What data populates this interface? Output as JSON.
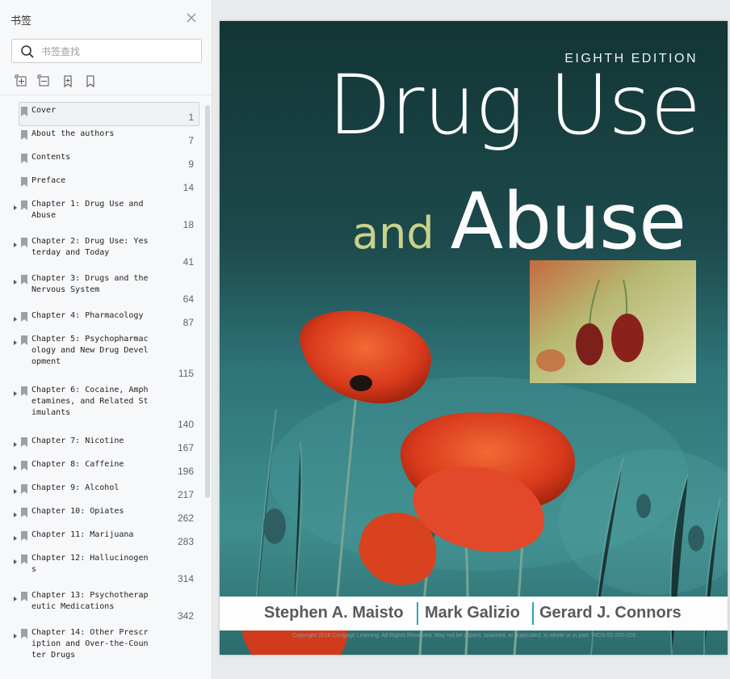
{
  "sidebar": {
    "title": "书签",
    "search_placeholder": "书签查找",
    "bookmarks": [
      {
        "label": "Cover",
        "page": "1",
        "expandable": false,
        "selected": true
      },
      {
        "label": "About the authors",
        "page": "7",
        "expandable": false
      },
      {
        "label": "Contents",
        "page": "9",
        "expandable": false
      },
      {
        "label": "Preface",
        "page": "14",
        "expandable": false
      },
      {
        "label": "Chapter 1: Drug Use and\nAbuse",
        "page": "18",
        "expandable": true
      },
      {
        "label": "Chapter 2: Drug Use: Yes\nterday and Today",
        "page": "41",
        "expandable": true
      },
      {
        "label": "Chapter 3: Drugs and the\nNervous System",
        "page": "64",
        "expandable": true
      },
      {
        "label": "Chapter 4: Pharmacology",
        "page": "87",
        "expandable": true
      },
      {
        "label": "Chapter 5: Psychopharmac\nology and New Drug Devel\nopment",
        "page": "115",
        "expandable": true
      },
      {
        "label": "Chapter 6: Cocaine, Amph\netamines, and Related St\nimulants",
        "page": "140",
        "expandable": true
      },
      {
        "label": "Chapter 7: Nicotine",
        "page": "167",
        "expandable": true
      },
      {
        "label": "Chapter 8: Caffeine",
        "page": "196",
        "expandable": true
      },
      {
        "label": "Chapter 9: Alcohol",
        "page": "217",
        "expandable": true
      },
      {
        "label": "Chapter 10: Opiates",
        "page": "262",
        "expandable": true
      },
      {
        "label": "Chapter 11: Marijuana",
        "page": "283",
        "expandable": true
      },
      {
        "label": "Chapter 12: Hallucinogen\ns",
        "page": "314",
        "expandable": true
      },
      {
        "label": "Chapter 13: Psychotherap\neutic Medications",
        "page": "342",
        "expandable": true
      },
      {
        "label": "Chapter 14: Other Prescr\niption and Over-the-Coun\nter Drugs",
        "page": "",
        "expandable": true
      }
    ]
  },
  "cover": {
    "edition": "EIGHTH EDITION",
    "title_line1": "Drug Use",
    "title_and": "and",
    "title_abuse": "Abuse",
    "authors": [
      "Stephen A. Maisto",
      "Mark Galizio",
      "Gerard J. Connors"
    ],
    "fineprint": "Copyright 2018 Cengage Learning. All Rights Reserved. May not be copied, scanned, or duplicated, in whole or in part. WCN 02-200-203"
  },
  "colors": {
    "teal_dark": "#173f40",
    "teal": "#2f7b7f",
    "poppy": "#e0401f",
    "and_green": "#c9d18a",
    "separator": "#2aa6b3"
  }
}
